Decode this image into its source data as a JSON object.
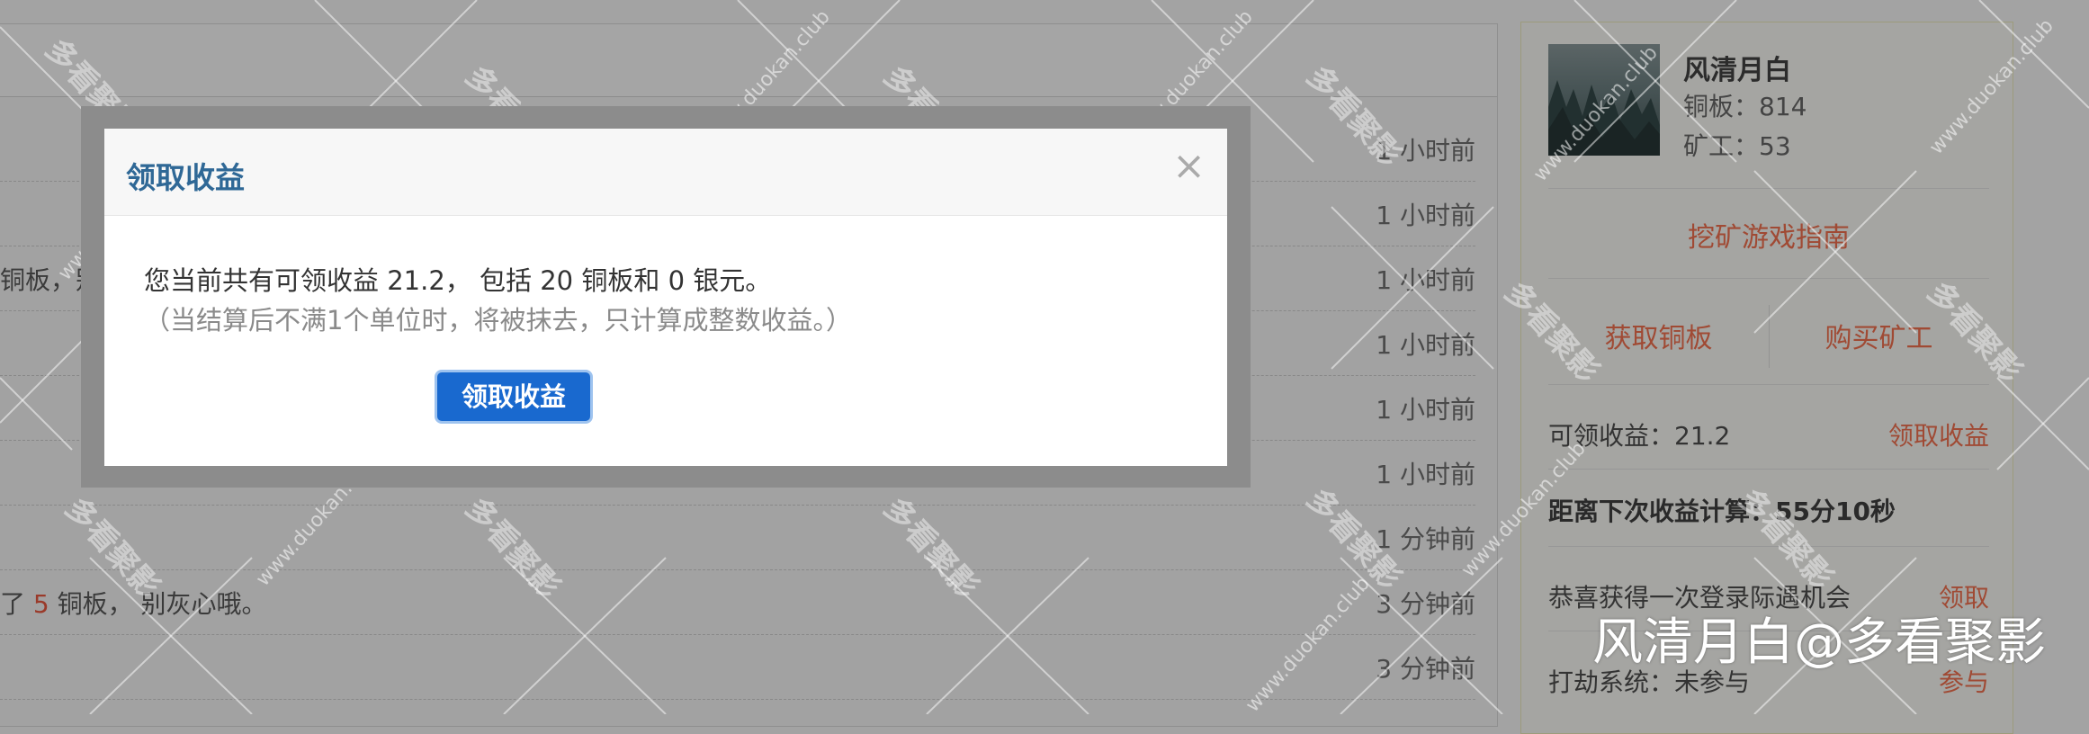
{
  "feed": {
    "rows": [
      {
        "text": "",
        "time": "1 小时前"
      },
      {
        "text": "",
        "time": "1 小时前"
      },
      {
        "text": "铜板，别",
        "time": "1 小时前"
      },
      {
        "text": "",
        "time": "1 小时前"
      },
      {
        "text": "",
        "time": "1 小时前"
      },
      {
        "text": "",
        "time": "1 小时前"
      },
      {
        "text": "",
        "time": "1 分钟前"
      },
      {
        "pre": "了 ",
        "highlight": "5",
        "post": " 铜板， 别灰心哦。",
        "time": "3 分钟前"
      },
      {
        "text": "",
        "time": "3 分钟前"
      }
    ]
  },
  "sidebar": {
    "username": "风清月白",
    "copper": "铜板：814",
    "miners": "矿工：53",
    "guide_link": "挖矿游戏指南",
    "get_copper": "获取铜板",
    "buy_miner": "购买矿工",
    "claimable_label": "可领收益：21.2",
    "claim_link": "领取收益",
    "next_calc": "距离下次收益计算：55分10秒",
    "lucky_label": "恭喜获得一次登录际遇机会",
    "lucky_link": "领取",
    "rob_label": "打劫系统：未参与",
    "rob_link": "参与"
  },
  "modal": {
    "title": "领取收益",
    "close": "×",
    "line1": "您当前共有可领收益 21.2， 包括 20 铜板和 0 银元。",
    "line2": "（当结算后不满1个单位时，将被抹去，只计算成整数收益。）",
    "button": "领取收益"
  },
  "watermark": {
    "url": "www.duokan.club",
    "cn": "多看聚影",
    "credit": "风清月白@多看聚影"
  }
}
